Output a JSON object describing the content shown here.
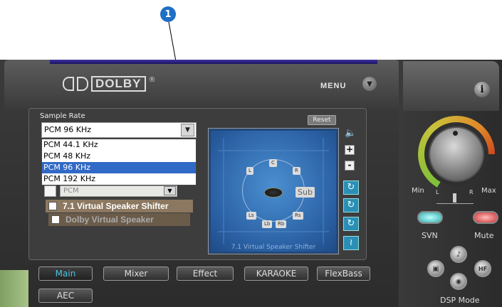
{
  "callout": {
    "number": "1"
  },
  "header": {
    "brand": "DOLBY",
    "registered_mark": "®",
    "menu_label": "MENU",
    "menu_icon": "chevron-down-icon",
    "info_icon": "info-icon",
    "info_glyph": "i"
  },
  "sample_rate": {
    "label": "Sample Rate",
    "selected": "PCM 96 KHz",
    "options": [
      "PCM 44.1 KHz",
      "PCM 48 KHz",
      "PCM 96 KHz",
      "PCM 192 KHz"
    ],
    "highlighted_index": 2
  },
  "pcm_select": {
    "value": "PCM"
  },
  "options": {
    "virtual_speaker_shifter": "7.1 Virtual Speaker Shifter",
    "dolby_virtual_speaker": "Dolby Virtual Speaker"
  },
  "speaker_panel": {
    "reset_label": "Reset",
    "caption": "7.1 Virtual Speaker Shifter",
    "speakers": [
      "L",
      "C",
      "R",
      "Sub",
      "Ls",
      "Rs",
      "Lb",
      "Rb"
    ]
  },
  "side_controls": {
    "plus": "+",
    "minus": "-",
    "volume_icon": "speaker-icon"
  },
  "tabs": [
    "Main",
    "Mixer",
    "Effect",
    "KARAOKE",
    "FlexBass",
    "AEC"
  ],
  "active_tab": "Main",
  "volume": {
    "min_label": "Min",
    "max_label": "Max",
    "left_label": "L",
    "right_label": "R"
  },
  "buttons": {
    "svn": "SVN",
    "mute": "Mute"
  },
  "dsp": {
    "label": "DSP Mode"
  },
  "colors": {
    "accent": "#49c5e6",
    "selection": "#3169c6",
    "callout": "#1f6fc5"
  }
}
